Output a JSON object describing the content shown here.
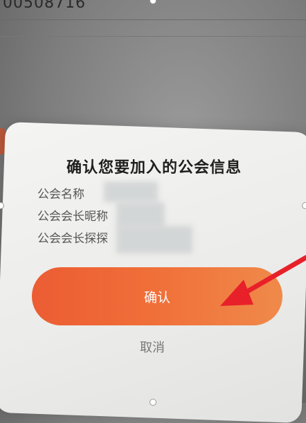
{
  "background": {
    "number_text": "00508716"
  },
  "dialog": {
    "title": "确认您要加入的公会信息",
    "rows": [
      {
        "label": "公会名称"
      },
      {
        "label": "公会会长昵称"
      },
      {
        "label": "公会会长探探"
      }
    ],
    "confirm_label": "确认",
    "cancel_label": "取消"
  },
  "colors": {
    "accent_start": "#ec5c33",
    "accent_end": "#ef8a4a",
    "annotation_arrow": "#e8202a"
  }
}
